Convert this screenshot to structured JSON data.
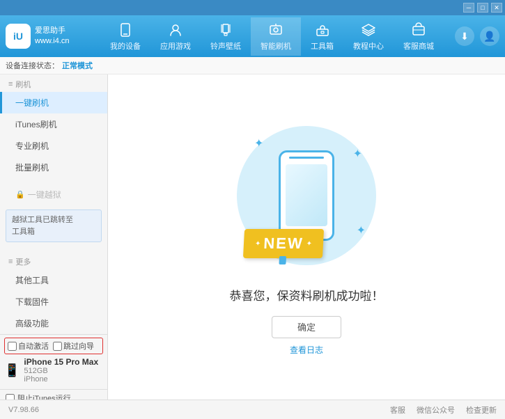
{
  "app": {
    "title": "爱思助手",
    "subtitle": "www.i4.cn",
    "logo_text": "iU"
  },
  "topbar": {
    "controls": [
      "minimize",
      "maximize",
      "close"
    ]
  },
  "nav": {
    "items": [
      {
        "id": "my-device",
        "label": "我的设备",
        "icon": "📱"
      },
      {
        "id": "apps-games",
        "label": "应用游戏",
        "icon": "👤"
      },
      {
        "id": "ringtone",
        "label": "铃声壁纸",
        "icon": "🔔"
      },
      {
        "id": "smart-flash",
        "label": "智能刷机",
        "icon": "🔄",
        "active": true
      },
      {
        "id": "toolbox",
        "label": "工具箱",
        "icon": "🧰"
      },
      {
        "id": "tutorial",
        "label": "教程中心",
        "icon": "🎓"
      },
      {
        "id": "service",
        "label": "客服商城",
        "icon": "💼"
      }
    ]
  },
  "status": {
    "label": "设备连接状态：",
    "value": "正常模式"
  },
  "sidebar": {
    "section_flash": "刷机",
    "items_flash": [
      {
        "id": "one-key-flash",
        "label": "一键刷机",
        "active": true
      },
      {
        "id": "itunes-flash",
        "label": "iTunes刷机"
      },
      {
        "id": "pro-flash",
        "label": "专业刷机"
      },
      {
        "id": "batch-flash",
        "label": "批量刷机"
      }
    ],
    "section_onekey": "一键越狱",
    "notice": "越狱工具已跳转至\n工具箱",
    "section_more": "更多",
    "items_more": [
      {
        "id": "other-tools",
        "label": "其他工具"
      },
      {
        "id": "download-firmware",
        "label": "下载固件"
      },
      {
        "id": "advanced",
        "label": "高级功能"
      }
    ],
    "auto_activate": "自动激活",
    "quick_guide": "跳过向导",
    "device_name": "iPhone 15 Pro Max",
    "device_storage": "512GB",
    "device_type": "iPhone",
    "itunes_label": "阻止iTunes运行"
  },
  "main": {
    "success_text": "恭喜您，保资料刷机成功啦！",
    "confirm_btn": "确定",
    "log_link": "查看日志",
    "new_badge": "NEW"
  },
  "footer": {
    "version": "V7.98.66",
    "links": [
      "客服",
      "微信公众号",
      "检查更新"
    ]
  }
}
